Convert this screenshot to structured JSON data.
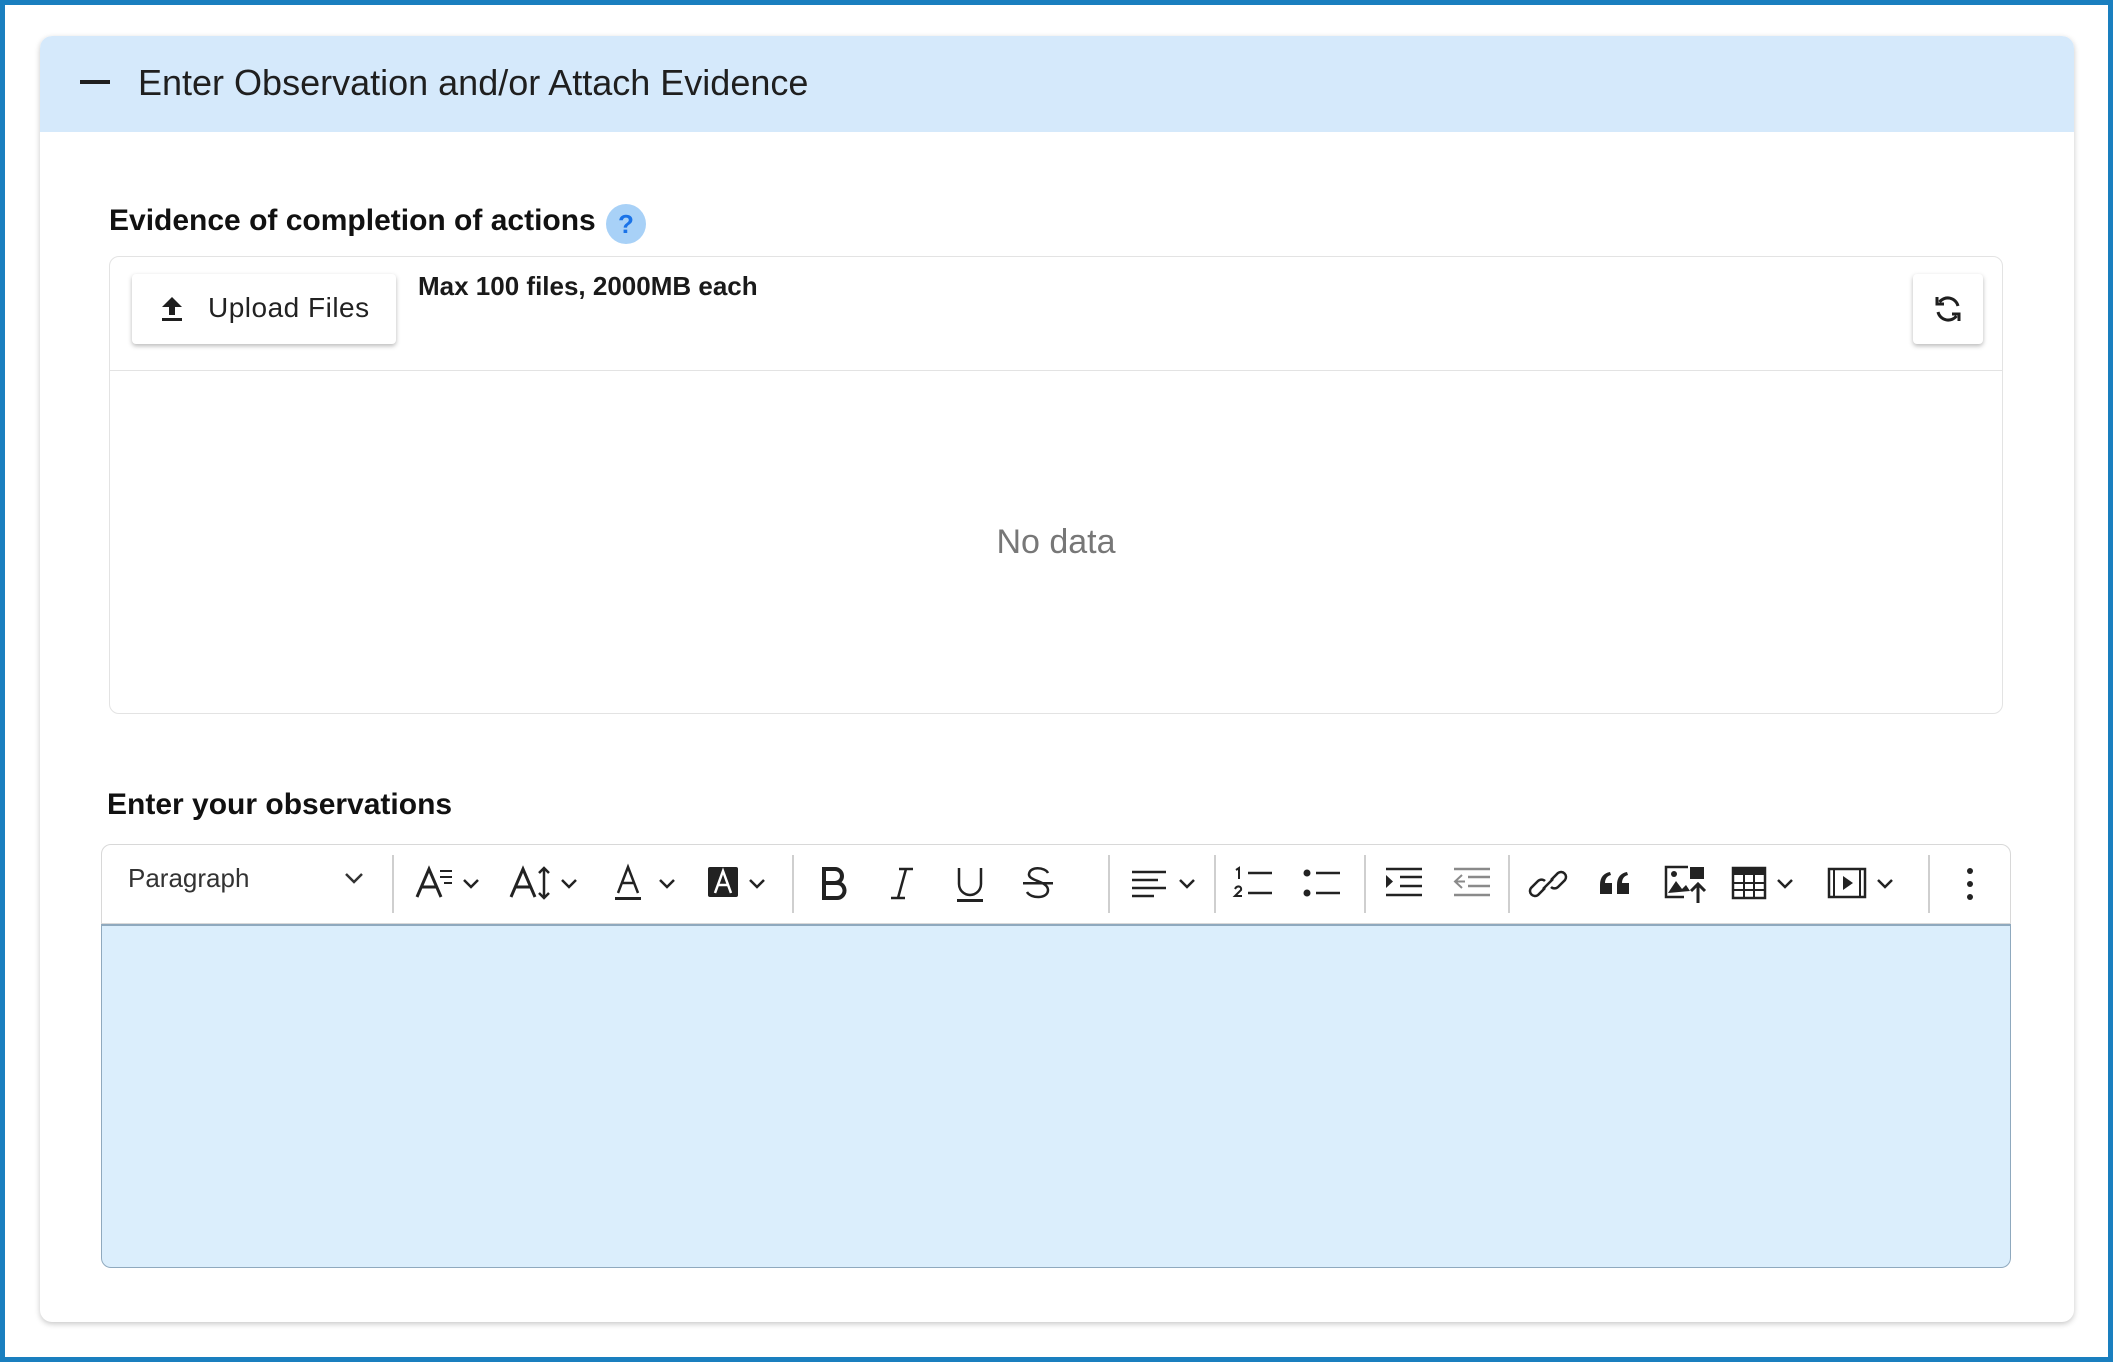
{
  "panel": {
    "title": "Enter Observation and/or Attach Evidence",
    "collapse_icon": "minus-icon"
  },
  "evidence": {
    "label": "Evidence of completion of actions",
    "help_icon": "?",
    "upload_label": "Upload Files",
    "upload_hint": "Max 100 files, 2000MB each",
    "empty_text": "No data"
  },
  "observations": {
    "label": "Enter your observations",
    "paragraph_style": "Paragraph",
    "toolbar_icons": [
      "font-family-icon",
      "font-size-icon",
      "font-color-icon",
      "highlight-color-icon",
      "bold-icon",
      "italic-icon",
      "underline-icon",
      "strikethrough-icon",
      "align-icon",
      "numbered-list-icon",
      "bulleted-list-icon",
      "indent-icon",
      "outdent-icon",
      "link-icon",
      "blockquote-icon",
      "insert-image-icon",
      "insert-table-icon",
      "insert-media-icon",
      "more-options-icon"
    ],
    "value": ""
  },
  "colors": {
    "frame_border": "#1a7fbf",
    "header_bg": "#d5e9fb",
    "editor_bg": "#dbeefc",
    "help_icon_bg": "#a8d1f7"
  }
}
